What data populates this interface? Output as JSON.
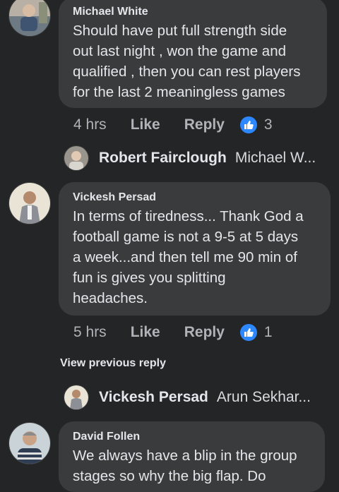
{
  "comments": [
    {
      "author": "Michael White",
      "text": "Should have put full strength side\nout last night , won the game and\nqualified , then you can rest players\nfor the last 2 meaningless games",
      "time": "4 hrs",
      "like_label": "Like",
      "reply_label": "Reply",
      "reaction_count": "3"
    },
    {
      "author": "Vickesh Persad",
      "text": "In terms of tiredness... Thank God a\nfootball game is not a 9-5 at 5 days\na week...and then tell me 90 min of\nfun is gives you splitting\nheadaches.",
      "time": "5 hrs",
      "like_label": "Like",
      "reply_label": "Reply",
      "reaction_count": "1"
    },
    {
      "author": "David Follen",
      "text": "We always have a blip in the group\nstages so why the big flap. Do"
    }
  ],
  "replies": [
    {
      "author": "Robert Fairclough",
      "preview": "Michael W..."
    },
    {
      "author": "Vickesh Persad",
      "preview": "Arun Sekhar..."
    }
  ],
  "view_previous_reply": "View previous reply",
  "colors": {
    "background": "#242526",
    "bubble": "#3a3b3c",
    "like_blue": "#2d88ff",
    "secondary_text": "#b0b3b8"
  }
}
